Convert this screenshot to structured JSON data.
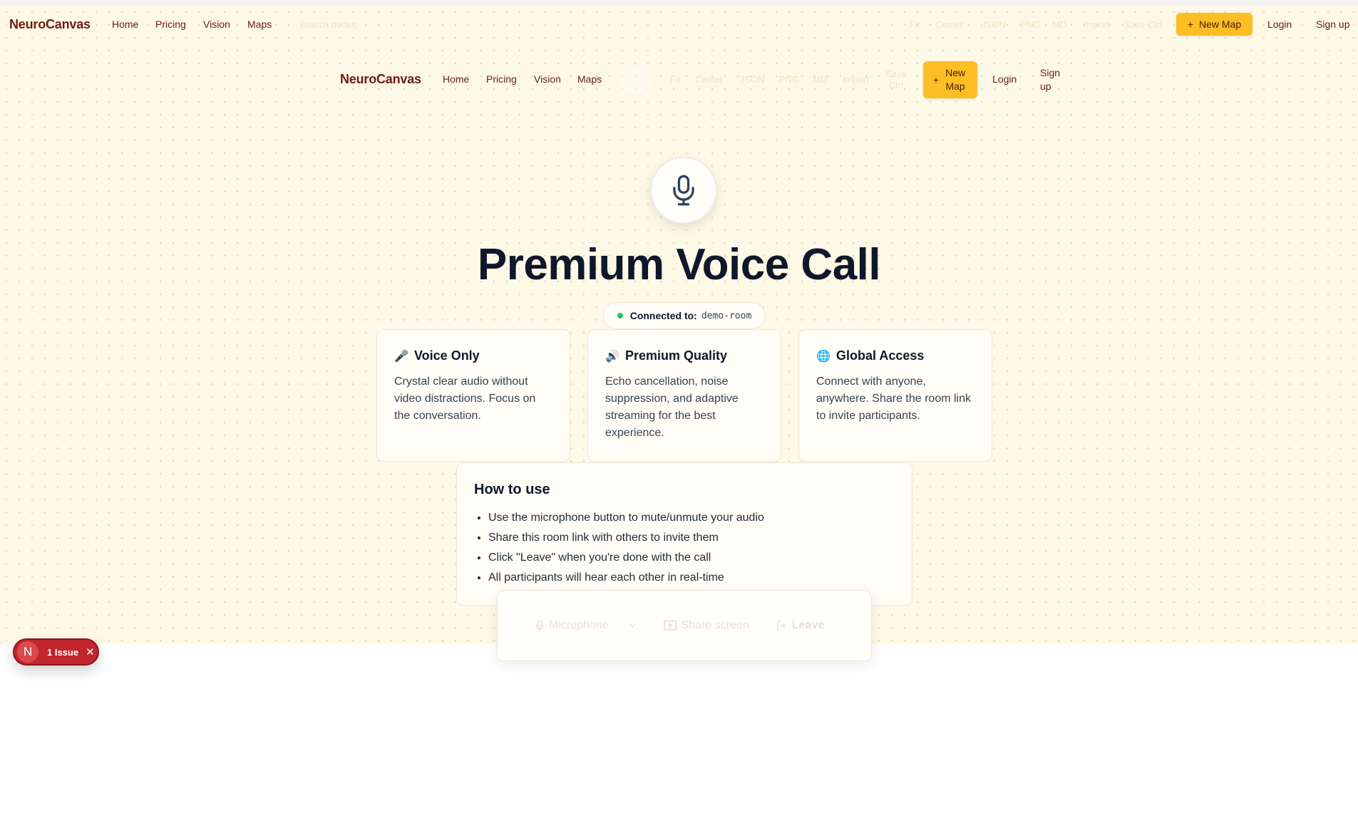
{
  "brand": "NeuroCanvas",
  "nav": {
    "links": [
      "Home",
      "Pricing",
      "Vision",
      "Maps"
    ],
    "search_placeholder": "Search nodes",
    "tools": [
      "Fit",
      "Center",
      "JSON",
      "PNG",
      "MD",
      "Import",
      "Save Ctrl"
    ],
    "tools2": [
      "Fit",
      "Center",
      "JSON",
      "PNG",
      "MD",
      "Import",
      "Save Ctrl"
    ],
    "new_map": "New Map",
    "new_map_icon": "+",
    "login": "Login",
    "signup": "Sign up"
  },
  "hero": {
    "title": "Premium Voice Call",
    "mic_icon": "microphone-icon",
    "connected_label": "Connected to:",
    "room": "demo-room",
    "status_color": "#22c55e"
  },
  "features": [
    {
      "icon": "🎤",
      "title": "Voice Only",
      "text": "Crystal clear audio without video distractions. Focus on the conversation."
    },
    {
      "icon": "🔊",
      "title": "Premium Quality",
      "text": "Echo cancellation, noise suppression, and adaptive streaming for the best experience."
    },
    {
      "icon": "🌐",
      "title": "Global Access",
      "text": "Connect with anyone, anywhere. Share the room link to invite participants."
    }
  ],
  "howto": {
    "title": "How to use",
    "items": [
      "Use the microphone button to mute/unmute your audio",
      "Share this room link with others to invite them",
      "Click \"Leave\" when you're done with the call",
      "All participants will hear each other in real-time"
    ]
  },
  "controls": {
    "microphone": "Microphone",
    "share_screen": "Share screen",
    "leave": "Leave"
  },
  "issue_badge": {
    "avatar": "N",
    "label": "1 Issue",
    "close": "✕"
  },
  "colors": {
    "brand": "#6b1d16",
    "accent": "#fbbf24",
    "background": "#fef8e6",
    "issue": "#c1272d"
  }
}
